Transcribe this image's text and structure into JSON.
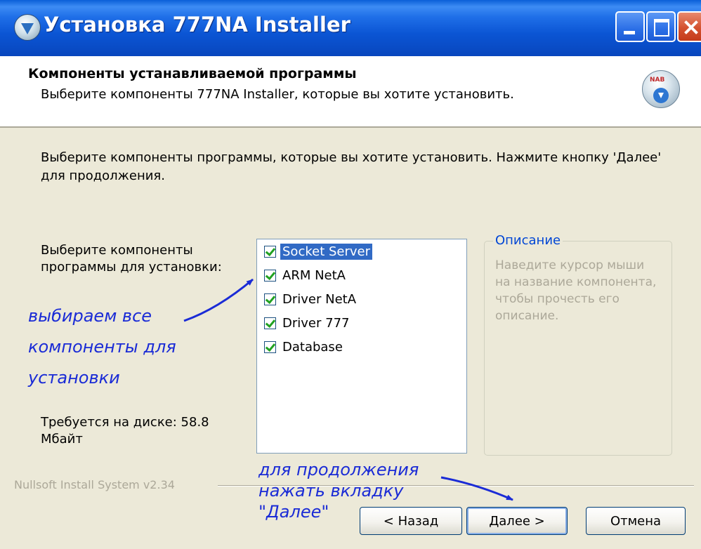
{
  "window": {
    "title": "Установка 777NA Installer"
  },
  "header": {
    "title": "Компоненты устанавливаемой программы",
    "subtitle": "Выберите компоненты 777NA Installer, которые вы хотите установить.",
    "logo_text": "NAB"
  },
  "body": {
    "intro": "Выберите компоненты программы, которые вы хотите установить. Нажмите кнопку 'Далее' для продолжения.",
    "select_label": "Выберите компоненты программы для установки:",
    "disk_required": "Требуется на диске: 58.8 Мбайт"
  },
  "components": [
    {
      "label": "Socket Server",
      "checked": true,
      "selected": true
    },
    {
      "label": "ARM NetA",
      "checked": true,
      "selected": false
    },
    {
      "label": "Driver NetA",
      "checked": true,
      "selected": false
    },
    {
      "label": "Driver 777",
      "checked": true,
      "selected": false
    },
    {
      "label": "Database",
      "checked": true,
      "selected": false
    }
  ],
  "description": {
    "legend": "Описание",
    "placeholder": "Наведите курсор мыши на название компонента, чтобы прочесть его описание."
  },
  "footer": {
    "branding": "Nullsoft Install System v2.34"
  },
  "buttons": {
    "back": "< Назад",
    "next": "Далее >",
    "cancel": "Отмена"
  },
  "annotations": {
    "select_all": [
      "выбираем все",
      "компоненты для",
      "установки"
    ],
    "continue": [
      "для продолжения",
      "нажать вкладку",
      "\"Далее\""
    ]
  },
  "colors": {
    "annotation": "#1a2bd6",
    "titlebar": "#0b55d4",
    "selection": "#316ac5",
    "dialog_bg": "#ece9d8"
  }
}
